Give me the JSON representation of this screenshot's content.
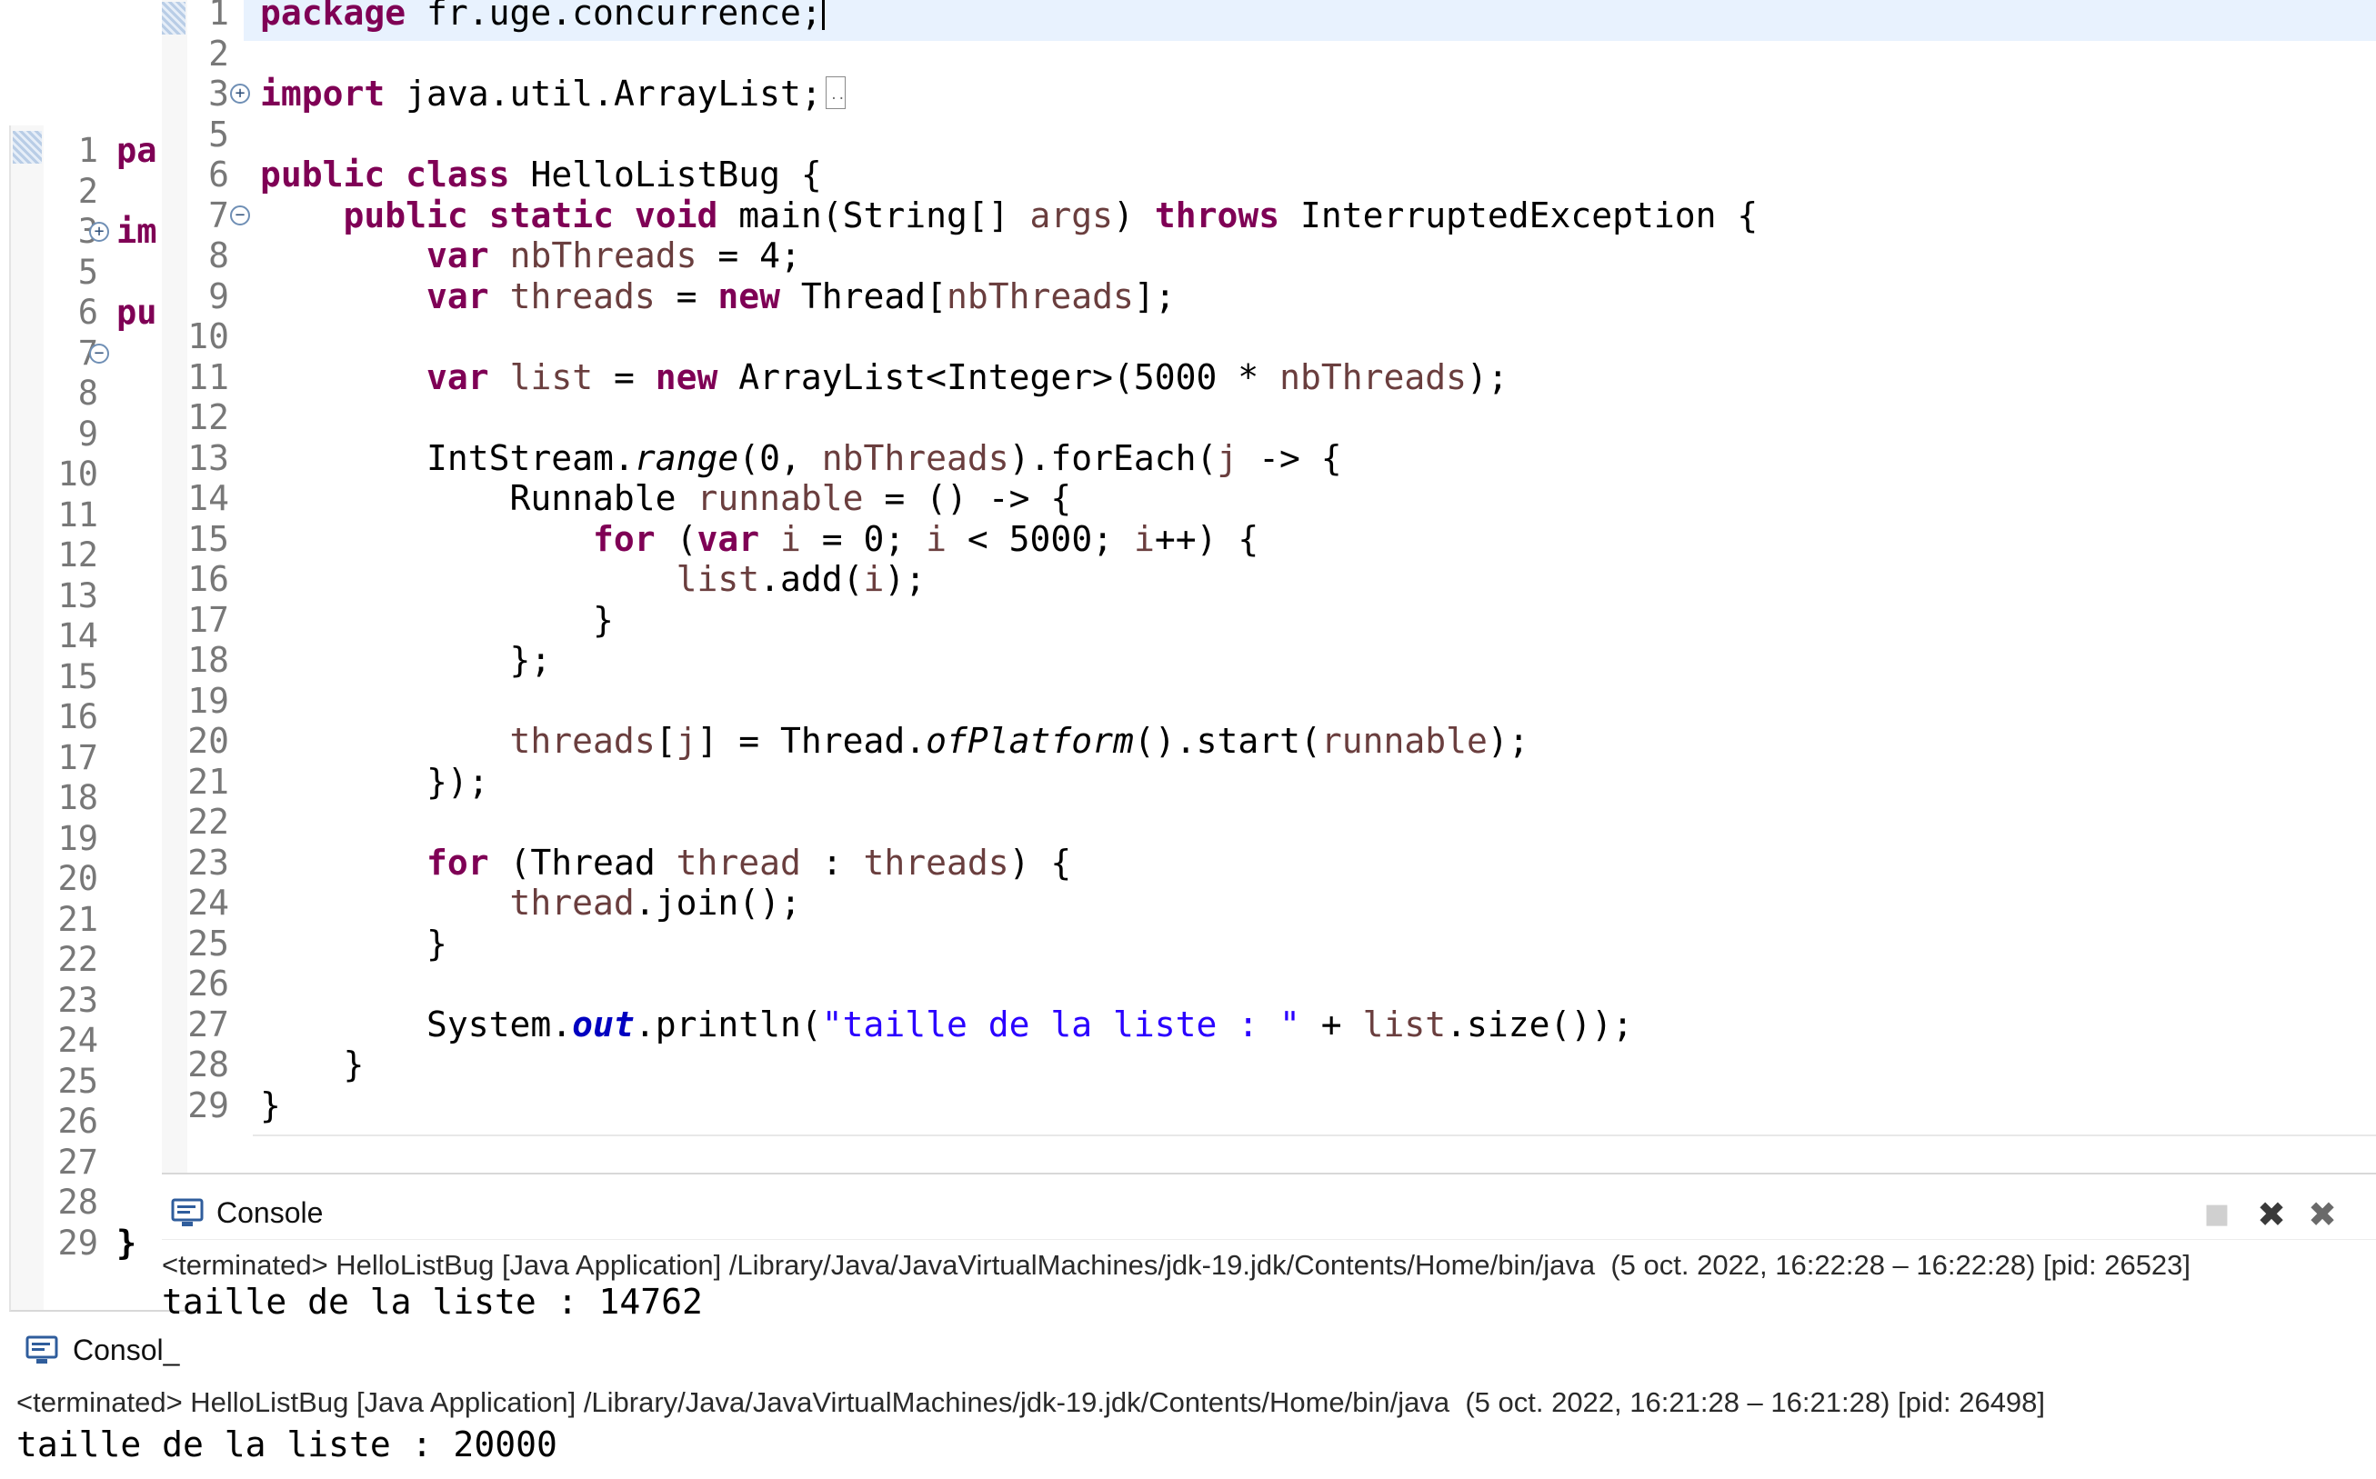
{
  "back_window": {
    "editor": {
      "lines": [
        {
          "num": "1",
          "code": "pa",
          "fold": ""
        },
        {
          "num": "2",
          "code": "",
          "fold": ""
        },
        {
          "num": "3",
          "code": "im",
          "fold": "+"
        },
        {
          "num": "5",
          "code": "",
          "fold": ""
        },
        {
          "num": "6",
          "code": "pu",
          "fold": ""
        },
        {
          "num": "7",
          "code": "",
          "fold": "−"
        },
        {
          "num": "8",
          "code": "",
          "fold": ""
        },
        {
          "num": "9",
          "code": "",
          "fold": ""
        },
        {
          "num": "10",
          "code": "",
          "fold": ""
        },
        {
          "num": "11",
          "code": "",
          "fold": ""
        },
        {
          "num": "12",
          "code": "",
          "fold": ""
        },
        {
          "num": "13",
          "code": "",
          "fold": ""
        },
        {
          "num": "14",
          "code": "",
          "fold": ""
        },
        {
          "num": "15",
          "code": "",
          "fold": ""
        },
        {
          "num": "16",
          "code": "",
          "fold": ""
        },
        {
          "num": "17",
          "code": "",
          "fold": ""
        },
        {
          "num": "18",
          "code": "",
          "fold": ""
        },
        {
          "num": "19",
          "code": "",
          "fold": ""
        },
        {
          "num": "20",
          "code": "",
          "fold": ""
        },
        {
          "num": "21",
          "code": "",
          "fold": ""
        },
        {
          "num": "22",
          "code": "",
          "fold": ""
        },
        {
          "num": "23",
          "code": "",
          "fold": ""
        },
        {
          "num": "24",
          "code": "",
          "fold": ""
        },
        {
          "num": "25",
          "code": "",
          "fold": ""
        },
        {
          "num": "26",
          "code": "",
          "fold": ""
        },
        {
          "num": "27",
          "code": "",
          "fold": ""
        },
        {
          "num": "28",
          "code": "",
          "fold": ""
        },
        {
          "num": "29",
          "code": "}",
          "fold": ""
        }
      ]
    },
    "console": {
      "tab_label": "Consol_",
      "status": "<terminated> HelloListBug [Java Application] /Library/Java/JavaVirtualMachines/jdk-19.jdk/Contents/Home/bin/java  (5 oct. 2022, 16:21:28 – 16:21:28) [pid: 26498]",
      "output": "taille de la liste : 20000"
    }
  },
  "front_window": {
    "editor": {
      "file_class": "HelloListBug",
      "lines": [
        {
          "num": "1",
          "fold": ""
        },
        {
          "num": "2",
          "fold": ""
        },
        {
          "num": "3",
          "fold": "+"
        },
        {
          "num": "5",
          "fold": ""
        },
        {
          "num": "6",
          "fold": ""
        },
        {
          "num": "7",
          "fold": "−"
        },
        {
          "num": "8",
          "fold": ""
        },
        {
          "num": "9",
          "fold": ""
        },
        {
          "num": "10",
          "fold": ""
        },
        {
          "num": "11",
          "fold": ""
        },
        {
          "num": "12",
          "fold": ""
        },
        {
          "num": "13",
          "fold": ""
        },
        {
          "num": "14",
          "fold": ""
        },
        {
          "num": "15",
          "fold": ""
        },
        {
          "num": "16",
          "fold": ""
        },
        {
          "num": "17",
          "fold": ""
        },
        {
          "num": "18",
          "fold": ""
        },
        {
          "num": "19",
          "fold": ""
        },
        {
          "num": "20",
          "fold": ""
        },
        {
          "num": "21",
          "fold": ""
        },
        {
          "num": "22",
          "fold": ""
        },
        {
          "num": "23",
          "fold": ""
        },
        {
          "num": "24",
          "fold": ""
        },
        {
          "num": "25",
          "fold": ""
        },
        {
          "num": "26",
          "fold": ""
        },
        {
          "num": "27",
          "fold": ""
        },
        {
          "num": "28",
          "fold": ""
        },
        {
          "num": "29",
          "fold": ""
        }
      ],
      "tokens": {
        "l1": [
          {
            "t": "package",
            "c": "kw"
          },
          {
            "t": " fr.uge.concurrence;",
            "c": ""
          }
        ],
        "l3": [
          {
            "t": "import",
            "c": "kw"
          },
          {
            "t": " java.util.ArrayList;",
            "c": ""
          }
        ],
        "l6": [
          {
            "t": "public",
            "c": "kw"
          },
          {
            "t": " ",
            "c": ""
          },
          {
            "t": "class",
            "c": "kw"
          },
          {
            "t": " HelloListBug {",
            "c": ""
          }
        ],
        "l7": [
          {
            "t": "    ",
            "c": ""
          },
          {
            "t": "public",
            "c": "kw"
          },
          {
            "t": " ",
            "c": ""
          },
          {
            "t": "static",
            "c": "kw"
          },
          {
            "t": " ",
            "c": ""
          },
          {
            "t": "void",
            "c": "kw"
          },
          {
            "t": " main(String[] ",
            "c": ""
          },
          {
            "t": "args",
            "c": "lv"
          },
          {
            "t": ") ",
            "c": ""
          },
          {
            "t": "throws",
            "c": "kw"
          },
          {
            "t": " InterruptedException {",
            "c": ""
          }
        ],
        "l8": [
          {
            "t": "        ",
            "c": ""
          },
          {
            "t": "var",
            "c": "kw"
          },
          {
            "t": " ",
            "c": ""
          },
          {
            "t": "nbThreads",
            "c": "lv"
          },
          {
            "t": " = 4;",
            "c": ""
          }
        ],
        "l9": [
          {
            "t": "        ",
            "c": ""
          },
          {
            "t": "var",
            "c": "kw"
          },
          {
            "t": " ",
            "c": ""
          },
          {
            "t": "threads",
            "c": "lv"
          },
          {
            "t": " = ",
            "c": ""
          },
          {
            "t": "new",
            "c": "kw"
          },
          {
            "t": " Thread[",
            "c": ""
          },
          {
            "t": "nbThreads",
            "c": "lv"
          },
          {
            "t": "];",
            "c": ""
          }
        ],
        "l11": [
          {
            "t": "        ",
            "c": ""
          },
          {
            "t": "var",
            "c": "kw"
          },
          {
            "t": " ",
            "c": ""
          },
          {
            "t": "list",
            "c": "lv"
          },
          {
            "t": " = ",
            "c": ""
          },
          {
            "t": "new",
            "c": "kw"
          },
          {
            "t": " ArrayList<Integer>(5000 * ",
            "c": ""
          },
          {
            "t": "nbThreads",
            "c": "lv"
          },
          {
            "t": ");",
            "c": ""
          }
        ],
        "l13": [
          {
            "t": "        IntStream.",
            "c": ""
          },
          {
            "t": "range",
            "c": "static-m"
          },
          {
            "t": "(0, ",
            "c": ""
          },
          {
            "t": "nbThreads",
            "c": "lv"
          },
          {
            "t": ").forEach(",
            "c": ""
          },
          {
            "t": "j",
            "c": "lv"
          },
          {
            "t": " -> {",
            "c": ""
          }
        ],
        "l14": [
          {
            "t": "            Runnable ",
            "c": ""
          },
          {
            "t": "runnable",
            "c": "lv"
          },
          {
            "t": " = () -> {",
            "c": ""
          }
        ],
        "l15": [
          {
            "t": "                ",
            "c": ""
          },
          {
            "t": "for",
            "c": "kw"
          },
          {
            "t": " (",
            "c": ""
          },
          {
            "t": "var",
            "c": "kw"
          },
          {
            "t": " ",
            "c": ""
          },
          {
            "t": "i",
            "c": "lv"
          },
          {
            "t": " = 0; ",
            "c": ""
          },
          {
            "t": "i",
            "c": "lv"
          },
          {
            "t": " < 5000; ",
            "c": ""
          },
          {
            "t": "i",
            "c": "lv"
          },
          {
            "t": "++) {",
            "c": ""
          }
        ],
        "l16": [
          {
            "t": "                    ",
            "c": ""
          },
          {
            "t": "list",
            "c": "lv"
          },
          {
            "t": ".add(",
            "c": ""
          },
          {
            "t": "i",
            "c": "lv"
          },
          {
            "t": ");",
            "c": ""
          }
        ],
        "l17": [
          {
            "t": "                }",
            "c": ""
          }
        ],
        "l18": [
          {
            "t": "            };",
            "c": ""
          }
        ],
        "l20": [
          {
            "t": "            ",
            "c": ""
          },
          {
            "t": "threads",
            "c": "lv"
          },
          {
            "t": "[",
            "c": ""
          },
          {
            "t": "j",
            "c": "lv"
          },
          {
            "t": "] = Thread.",
            "c": ""
          },
          {
            "t": "ofPlatform",
            "c": "static-m"
          },
          {
            "t": "().start(",
            "c": ""
          },
          {
            "t": "runnable",
            "c": "lv"
          },
          {
            "t": ");",
            "c": ""
          }
        ],
        "l21": [
          {
            "t": "        });",
            "c": ""
          }
        ],
        "l23": [
          {
            "t": "        ",
            "c": ""
          },
          {
            "t": "for",
            "c": "kw"
          },
          {
            "t": " (Thread ",
            "c": ""
          },
          {
            "t": "thread",
            "c": "lv"
          },
          {
            "t": " : ",
            "c": ""
          },
          {
            "t": "threads",
            "c": "lv"
          },
          {
            "t": ") {",
            "c": ""
          }
        ],
        "l24": [
          {
            "t": "            ",
            "c": ""
          },
          {
            "t": "thread",
            "c": "lv"
          },
          {
            "t": ".join();",
            "c": ""
          }
        ],
        "l25": [
          {
            "t": "        }",
            "c": ""
          }
        ],
        "l27": [
          {
            "t": "        System.",
            "c": ""
          },
          {
            "t": "out",
            "c": "static-fld"
          },
          {
            "t": ".println(",
            "c": ""
          },
          {
            "t": "\"taille de la liste : \"",
            "c": "str"
          },
          {
            "t": " + ",
            "c": ""
          },
          {
            "t": "list",
            "c": "lv"
          },
          {
            "t": ".size());",
            "c": ""
          }
        ],
        "l28": [
          {
            "t": "    }",
            "c": ""
          }
        ],
        "l29": [
          {
            "t": "}",
            "c": ""
          }
        ]
      }
    },
    "console": {
      "tab_label": "Console",
      "status": "<terminated> HelloListBug [Java Application] /Library/Java/JavaVirtualMachines/jdk-19.jdk/Contents/Home/bin/java  (5 oct. 2022, 16:22:28 – 16:22:28) [pid: 26523]",
      "output": "taille de la liste : 14762",
      "tools": [
        {
          "name": "terminate-icon",
          "glyph": "■"
        },
        {
          "name": "remove-launch-icon",
          "glyph": "✖"
        },
        {
          "name": "remove-all-terminated-icon",
          "glyph": "✖"
        }
      ]
    }
  },
  "colors": {
    "keyword": "#7f0055",
    "local_variable": "#6a3e3e",
    "string": "#2a00ff",
    "static_field": "#0000c0",
    "line_number": "#787878",
    "current_line": "#e8f2fe"
  }
}
